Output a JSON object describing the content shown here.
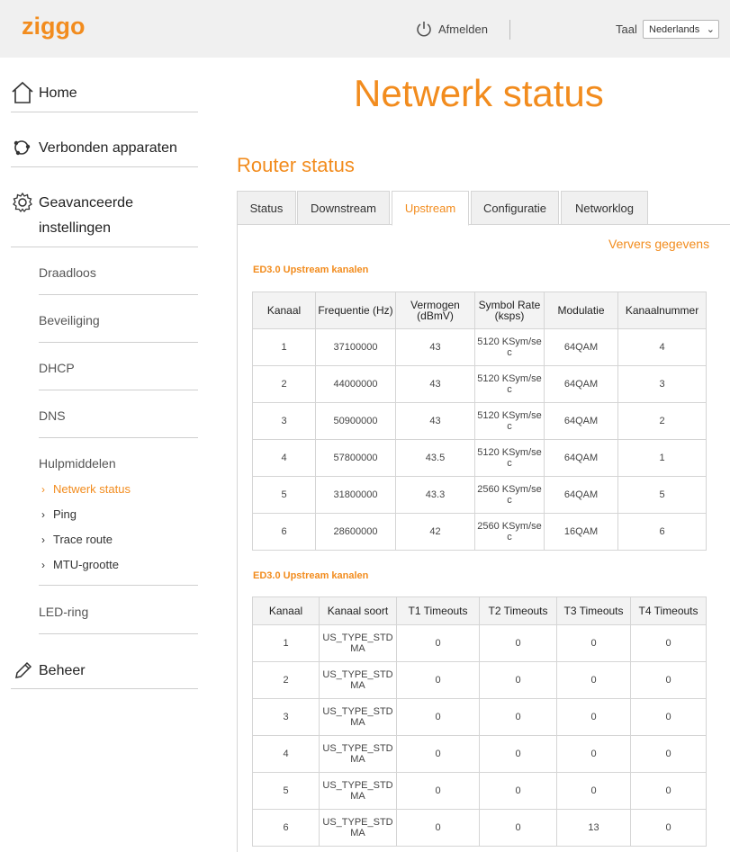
{
  "header": {
    "brand": "ziggo",
    "logout_label": "Afmelden",
    "language_label": "Taal",
    "language_value": "Nederlands"
  },
  "sidebar": {
    "home": "Home",
    "devices": "Verbonden apparaten",
    "advanced_line1": "Geavanceerde",
    "advanced_line2": "instellingen",
    "sub_items": [
      "Draadloos",
      "Beveiliging",
      "DHCP",
      "DNS"
    ],
    "tools_title": "Hulpmiddelen",
    "tools": [
      "Netwerk status",
      "Ping",
      "Trace route",
      "MTU-grootte"
    ],
    "led": "LED-ring",
    "admin": "Beheer"
  },
  "main": {
    "page_title": "Netwerk status",
    "section_title": "Router status",
    "tabs": [
      "Status",
      "Downstream",
      "Upstream",
      "Configuratie",
      "Networklog"
    ],
    "active_tab": "Upstream",
    "refresh_label": "Ververs gegevens",
    "table1": {
      "caption": "ED3.0 Upstream kanalen",
      "headers": [
        "Kanaal",
        "Frequentie (Hz)",
        "Vermogen (dBmV)",
        "Symbol Rate (ksps)",
        "Modulatie",
        "Kanaalnummer"
      ],
      "rows": [
        [
          "1",
          "37100000",
          "43",
          "5120 KSym/sec",
          "64QAM",
          "4"
        ],
        [
          "2",
          "44000000",
          "43",
          "5120 KSym/sec",
          "64QAM",
          "3"
        ],
        [
          "3",
          "50900000",
          "43",
          "5120 KSym/sec",
          "64QAM",
          "2"
        ],
        [
          "4",
          "57800000",
          "43.5",
          "5120 KSym/sec",
          "64QAM",
          "1"
        ],
        [
          "5",
          "31800000",
          "43.3",
          "2560 KSym/sec",
          "64QAM",
          "5"
        ],
        [
          "6",
          "28600000",
          "42",
          "2560 KSym/sec",
          "16QAM",
          "6"
        ]
      ]
    },
    "table2": {
      "caption": "ED3.0 Upstream kanalen",
      "headers": [
        "Kanaal",
        "Kanaal soort",
        "T1 Timeouts",
        "T2 Timeouts",
        "T3 Timeouts",
        "T4 Timeouts"
      ],
      "rows": [
        [
          "1",
          "US_TYPE_STDMA",
          "0",
          "0",
          "0",
          "0"
        ],
        [
          "2",
          "US_TYPE_STDMA",
          "0",
          "0",
          "0",
          "0"
        ],
        [
          "3",
          "US_TYPE_STDMA",
          "0",
          "0",
          "0",
          "0"
        ],
        [
          "4",
          "US_TYPE_STDMA",
          "0",
          "0",
          "0",
          "0"
        ],
        [
          "5",
          "US_TYPE_STDMA",
          "0",
          "0",
          "0",
          "0"
        ],
        [
          "6",
          "US_TYPE_STDMA",
          "0",
          "0",
          "13",
          "0"
        ]
      ]
    }
  },
  "colors": {
    "accent": "#f28c1e",
    "header_bg": "#f0f0f0",
    "border": "#d5d5d5"
  },
  "icons": [
    "home-icon",
    "devices-icon",
    "gear-icon",
    "pencil-icon",
    "power-icon",
    "chevron-right-icon"
  ]
}
